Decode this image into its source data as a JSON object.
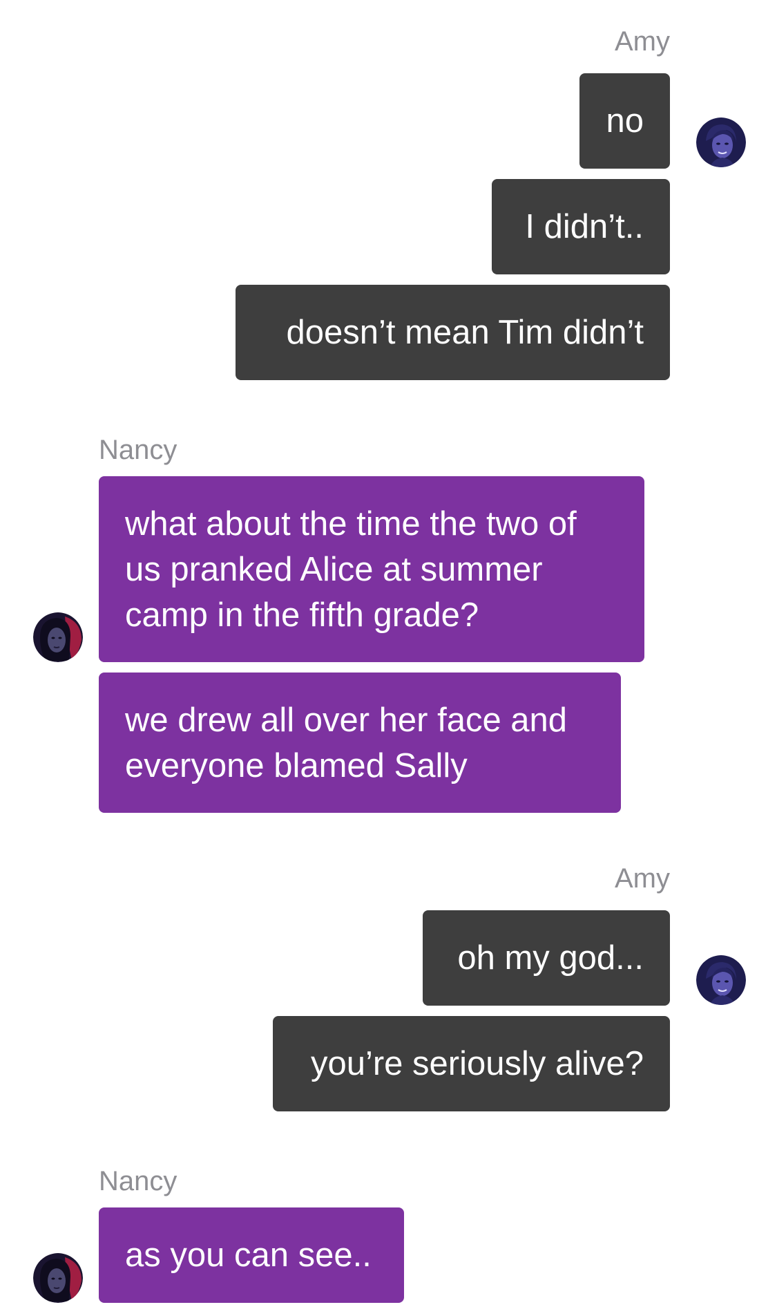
{
  "conversation": {
    "group1": {
      "sender": "Amy",
      "messages": [
        "no",
        "I didn’t..",
        "doesn’t mean Tim didn’t"
      ]
    },
    "group2": {
      "sender": "Nancy",
      "messages": [
        "what about the time the two of us pranked Alice at summer camp in the fifth grade?",
        "we drew all over her face and everyone blamed Sally"
      ]
    },
    "group3": {
      "sender": "Amy",
      "messages": [
        "oh my god...",
        "you’re seriously alive?"
      ]
    },
    "group4": {
      "sender": "Nancy",
      "messages": [
        "as you can see.."
      ]
    }
  },
  "colors": {
    "amy_bubble": "#3e3e3e",
    "nancy_bubble": "#7d32a0",
    "name_text": "#8e8e93",
    "background": "#ffffff"
  },
  "icons": {
    "amy_avatar": "amy-avatar-icon",
    "nancy_avatar": "nancy-avatar-icon"
  }
}
